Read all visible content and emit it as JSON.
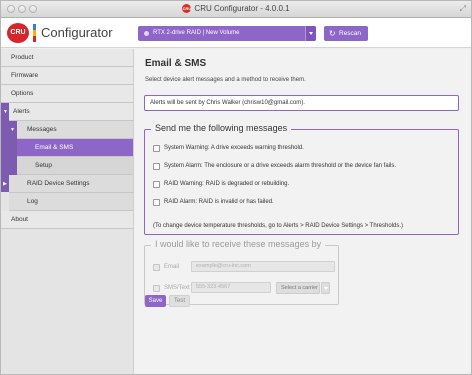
{
  "window": {
    "title": "CRU Configurator - 4.0.0.1"
  },
  "header": {
    "logo_badge": "CRU",
    "logo_text": "Configurator",
    "device": "RTX 2-drive RAID | New Volume",
    "rescan_label": "Rescan"
  },
  "sidebar": {
    "items": [
      {
        "label": "Product"
      },
      {
        "label": "Firmware"
      },
      {
        "label": "Options"
      },
      {
        "label": "Alerts"
      },
      {
        "label": "Messages"
      },
      {
        "label": "Email & SMS"
      },
      {
        "label": "Setup"
      },
      {
        "label": "RAID Device Settings"
      },
      {
        "label": "Log"
      },
      {
        "label": "About"
      }
    ]
  },
  "main": {
    "title": "Email & SMS",
    "subtitle": "Select device alert messages and a method to receive them.",
    "info": "Alerts will be sent by Chris Walker (chrisw10@gmail.com).",
    "messages_legend": "Send me the following messages",
    "messages": [
      "System Warning: A drive exceeds warning threshold.",
      "System Alarm: The enclosure or a drive exceeds alarm threshold or the device fan fails.",
      "RAID Warning: RAID is degraded or rebuilding.",
      "RAID Alarm: RAID is invalid or has failed."
    ],
    "thresholds_note": "(To change device temperature thresholds, go to Alerts > RAID Device Settings > Thresholds.)",
    "receive_legend": "I would like to receive these messages by",
    "email_label": "Email",
    "email_placeholder": "example@cru-inc.com",
    "sms_label": "SMS/Text",
    "sms_placeholder": "555-323-4567",
    "carrier_label": "Select a carrier",
    "save_label": "Save",
    "test_label": "Test"
  },
  "colors": {
    "accent": "#8e66c7",
    "sidebar_stripe": "#7c5bb0",
    "logo_red": "#d7262b"
  }
}
